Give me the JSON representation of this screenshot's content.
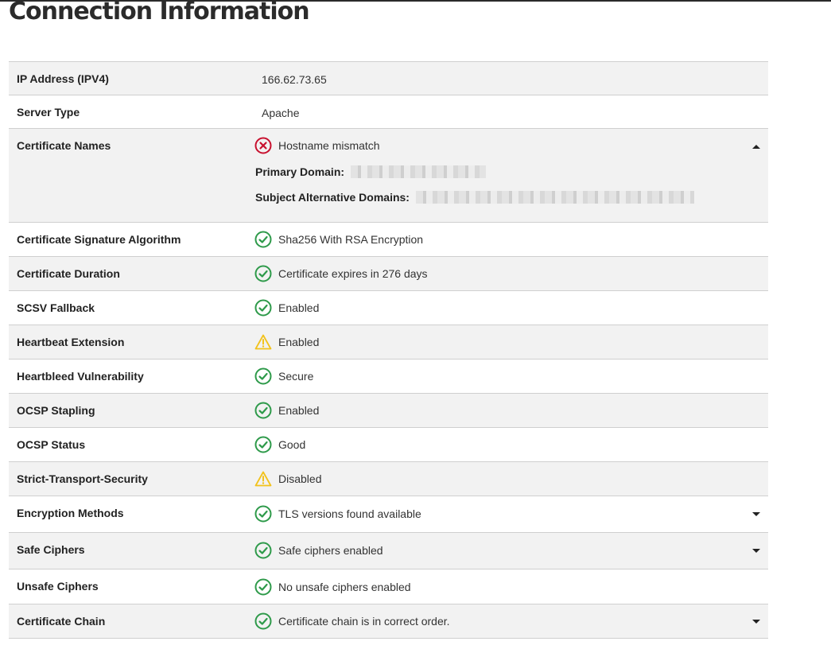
{
  "page": {
    "title": "Connection Information"
  },
  "rows": [
    {
      "label": "IP Address (IPV4)",
      "value": "166.62.73.65"
    },
    {
      "label": "Server Type",
      "value": "Apache"
    },
    {
      "label": "Certificate Names",
      "value": "Hostname mismatch",
      "status": "error",
      "primary_domain_label": "Primary Domain:",
      "alt_domains_label": "Subject Alternative Domains:"
    },
    {
      "label": "Certificate Signature Algorithm",
      "value": "Sha256 With RSA Encryption",
      "status": "ok"
    },
    {
      "label": "Certificate Duration",
      "value": "Certificate expires in 276 days",
      "status": "ok"
    },
    {
      "label": "SCSV Fallback",
      "value": "Enabled",
      "status": "ok"
    },
    {
      "label": "Heartbeat Extension",
      "value": "Enabled",
      "status": "warning"
    },
    {
      "label": "Heartbleed Vulnerability",
      "value": "Secure",
      "status": "ok"
    },
    {
      "label": "OCSP Stapling",
      "value": "Enabled",
      "status": "ok"
    },
    {
      "label": "OCSP Status",
      "value": "Good",
      "status": "ok"
    },
    {
      "label": "Strict-Transport-Security",
      "value": "Disabled",
      "status": "warning"
    },
    {
      "label": "Encryption Methods",
      "value": "TLS versions found available",
      "status": "ok"
    },
    {
      "label": "Safe Ciphers",
      "value": "Safe ciphers enabled",
      "status": "ok"
    },
    {
      "label": "Unsafe Ciphers",
      "value": "No unsafe ciphers enabled",
      "status": "ok"
    },
    {
      "label": "Certificate Chain",
      "value": "Certificate chain is in correct order.",
      "status": "ok"
    }
  ],
  "colors": {
    "ok": "#2e9a4a",
    "error": "#c8102e",
    "warning": "#f2c21b",
    "row_shade": "#f2f2f2",
    "divider": "#cfcfcf"
  },
  "icons": {
    "ok": "check-circle-icon",
    "error": "x-circle-icon",
    "warning": "warning-triangle-icon",
    "expand": "caret-down-icon",
    "collapse": "caret-up-icon"
  }
}
